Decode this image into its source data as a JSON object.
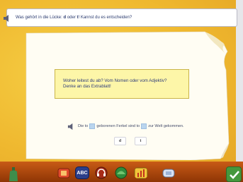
{
  "instruction": {
    "prefix": "Was gehört in die Lücke: ",
    "letter_d": "d",
    "middle": " oder ",
    "letter_t": "t",
    "suffix": "! Kannst du es entscheiden?"
  },
  "hint": {
    "line1": "Woher leitest du ab? Vom Nomen oder vom Adjektiv?",
    "line2": "Denke an das Extrablatt!"
  },
  "sentence": {
    "part1": "Die to",
    "part2": "geborenen Ferkel sind to",
    "part3": "zur Welt gekommen."
  },
  "choices": {
    "d": "d",
    "t": "t"
  },
  "toolbar": {
    "book_label": "ABC",
    "icons": [
      "bottle-icon",
      "crate-icon",
      "book-icon",
      "headphones-icon",
      "green-helmet-icon",
      "chart-icon",
      "letter-cards-icon",
      "checkmark-icon"
    ]
  },
  "colors": {
    "background": "#efb82f",
    "paper": "#fffdf3",
    "hint_box": "#fdf6a8",
    "gap_fill": "#b9d5ee",
    "toolbar": "#b0480d",
    "text_blue": "#2f3d7a"
  }
}
